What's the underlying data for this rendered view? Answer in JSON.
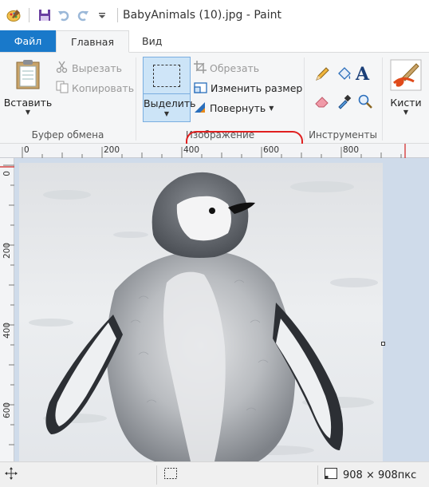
{
  "window": {
    "title": "BabyAnimals (10).jpg - Paint"
  },
  "quick_access": {
    "icons": [
      "paint-app-icon",
      "save-icon",
      "undo-icon",
      "redo-icon",
      "customize-arrow-icon"
    ]
  },
  "tabs": [
    {
      "label": "Файл"
    },
    {
      "label": "Главная"
    },
    {
      "label": "Вид"
    }
  ],
  "ribbon": {
    "clipboard": {
      "paste_label": "Вставить",
      "cut_label": "Вырезать",
      "copy_label": "Копировать",
      "group_label": "Буфер обмена"
    },
    "image": {
      "select_label": "Выделить",
      "crop_label": "Обрезать",
      "resize_label": "Изменить размер",
      "rotate_label": "Повернуть",
      "group_label": "Изображение"
    },
    "tools": {
      "group_label": "Инструменты",
      "items": [
        "pencil-icon",
        "fill-icon",
        "text-icon",
        "eraser-icon",
        "color-picker-icon",
        "magnifier-icon"
      ]
    },
    "brushes": {
      "label": "Кисти"
    }
  },
  "ruler": {
    "h_ticks": [
      "0",
      "200",
      "400",
      "600",
      "800"
    ],
    "v_ticks": [
      "0",
      "200",
      "400",
      "600"
    ]
  },
  "canvas": {
    "image_description": "baby penguin"
  },
  "status": {
    "dimensions": "908 × 908пкс"
  },
  "colors": {
    "accent": "#1979ca",
    "ribbon_bg": "#f5f6f7",
    "select_bg": "#cce4f7",
    "highlight_ring": "#e02020",
    "workspace": "#cfdbea"
  }
}
